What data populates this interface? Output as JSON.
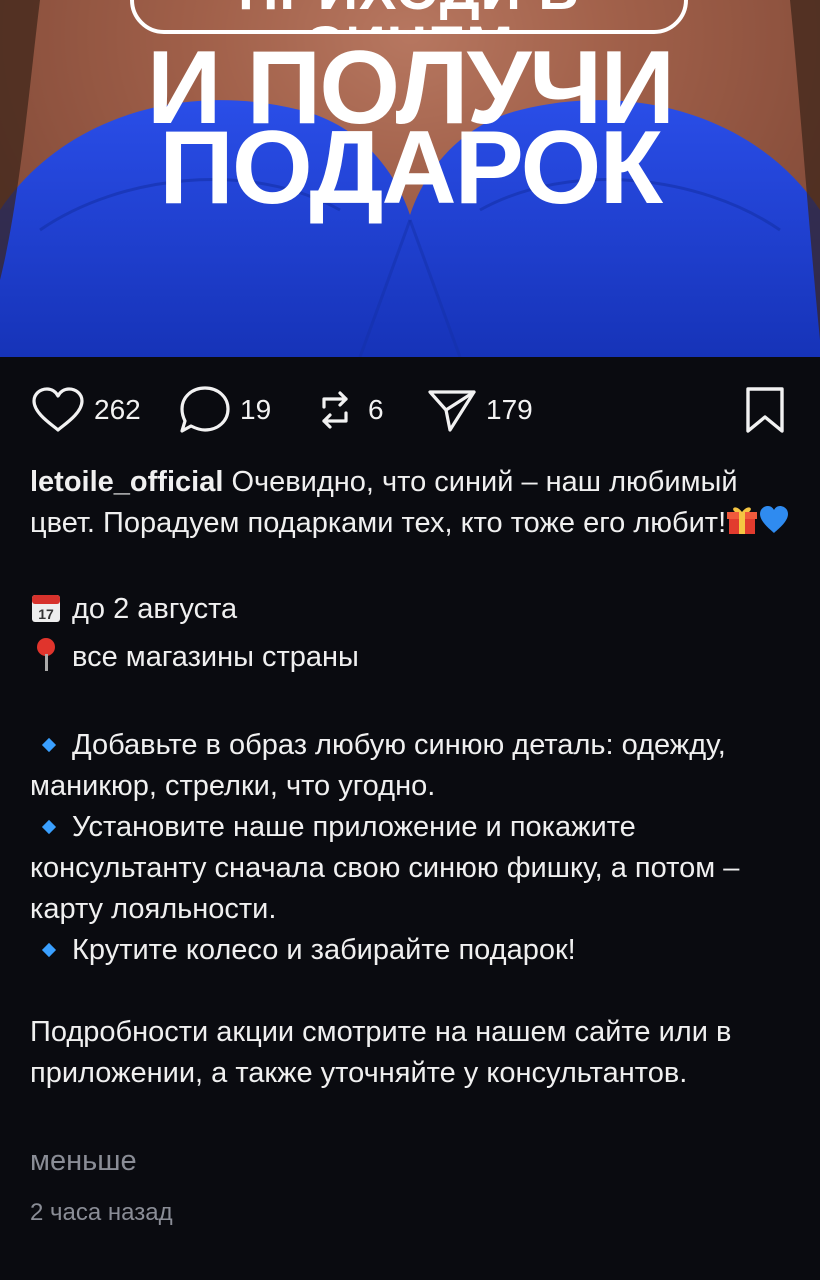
{
  "banner": {
    "pill_text": "ПРИХОДИ В СИНЕМ",
    "headline_line1": "И ПОЛУЧИ",
    "headline_line2": "ПОДАРОК"
  },
  "actions": {
    "likes": "262",
    "comments": "19",
    "reposts": "6",
    "shares": "179"
  },
  "caption": {
    "username": "letoile_official",
    "intro": " Очевидно, что синий – наш любимый цвет. Порадуем подарками тех, кто тоже его любит!",
    "date_line": "до 2 августа",
    "place_line": "все магазины страны",
    "bullet1": "Добавьте в образ любую синюю деталь: одежду, маникюр, стрелки, что угодно.",
    "bullet2": "Установите наше приложение и покажите консультанту сначала свою синюю фишку, а потом – карту лояльности.",
    "bullet3": "Крутите колесо и забирайте подарок!",
    "outro": "Подробности акции смотрите на нашем сайте или в приложении, а также уточняйте у консультантов.",
    "less_label": "меньше"
  },
  "meta": {
    "timestamp": "2 часа назад"
  },
  "icons": {
    "like": "heart-outline-icon",
    "comment": "speech-bubble-icon",
    "repost": "repost-arrows-icon",
    "share": "paper-plane-icon",
    "save": "bookmark-icon",
    "gift": "gift-emoji",
    "heart": "blue-heart-emoji",
    "calendar": "calendar-emoji",
    "pin": "pin-emoji",
    "bullet": "blue-diamond-emoji"
  },
  "colors": {
    "background": "#0a0b10",
    "accent_blue": "#1d3fd0",
    "muted_text": "#8a8d96"
  }
}
